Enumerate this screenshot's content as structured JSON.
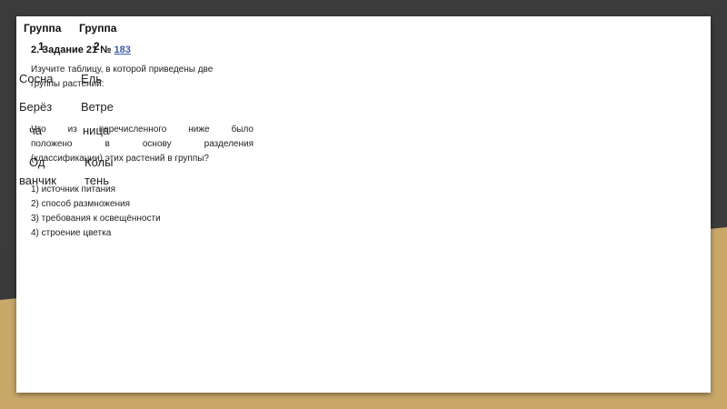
{
  "table": {
    "headers": [
      {
        "line1": "Группа",
        "line2": "1"
      },
      {
        "line1": "Группа",
        "line2": "2"
      }
    ],
    "rows": [
      {
        "0": "Сосна",
        "1": "Ель"
      },
      {
        "0a": "Берёз",
        "0b": "ча",
        "1a": "Ветре",
        "1b": "ница"
      },
      {
        "0a": "Од",
        "0b": "ванчик",
        "1a": "Колы",
        "1b": "тень"
      }
    ]
  },
  "task": {
    "title": "2. Задание 21 №",
    "number": "183",
    "instruction_line1": "Изучите таблицу, в которой приведены две",
    "instruction_line2": "группы растений:",
    "question_line1": "Что из перечисленного ниже было",
    "question_line2": "положено в основу разделения",
    "question_line3": "(классификации) этих растений в группы?",
    "options": [
      "1) источник питания",
      "2) способ размножения",
      "3) требования к освещённости",
      "4) строение цветка"
    ]
  },
  "colors": {
    "background": "#3a3a3a",
    "accent_band": "#c9a86a",
    "slide": "#ffffff",
    "link": "#3a5ea8"
  }
}
